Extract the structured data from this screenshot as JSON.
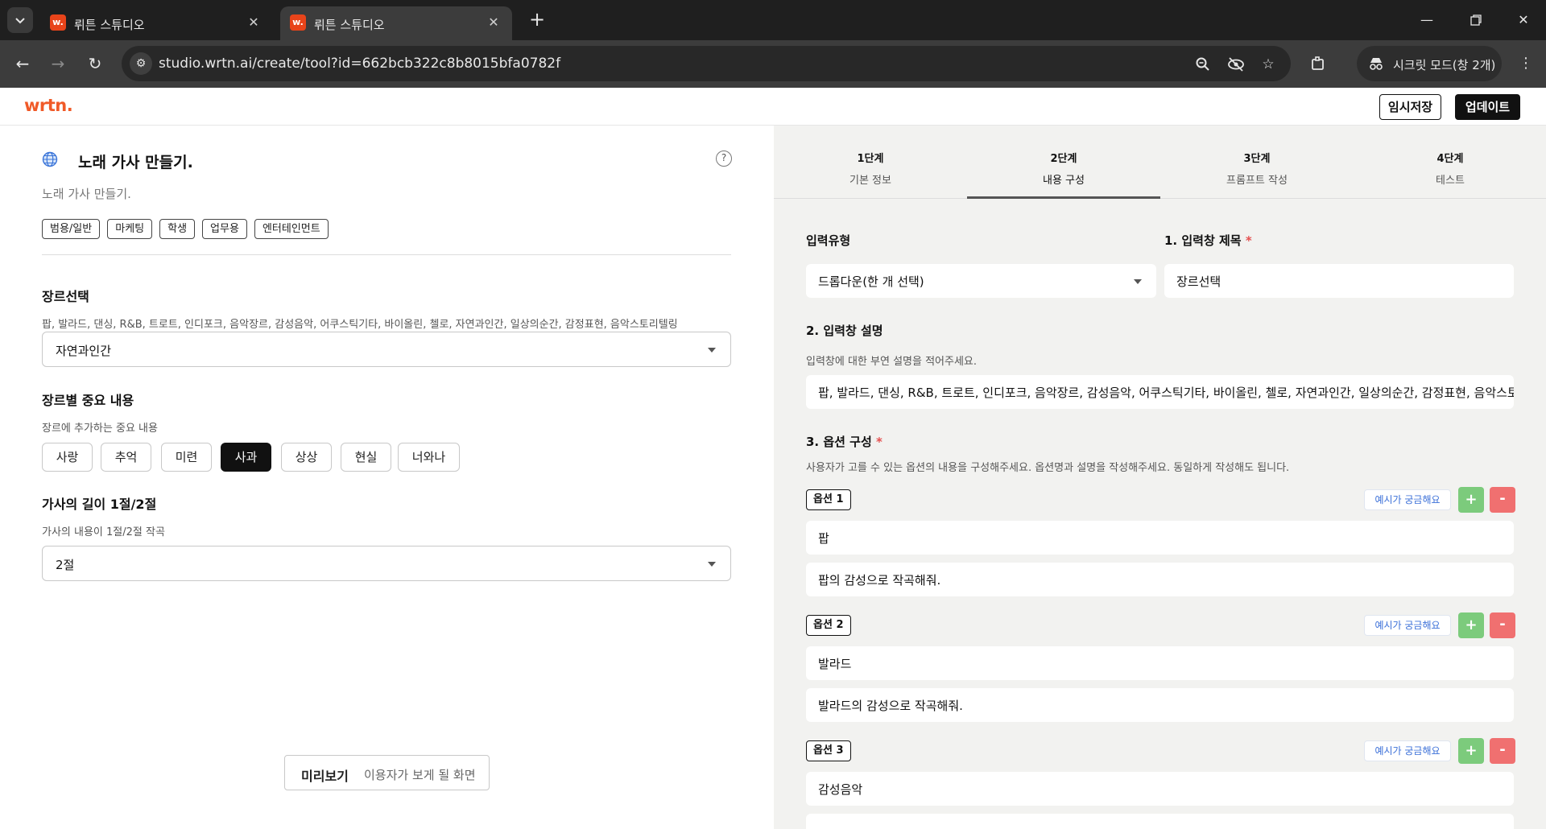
{
  "browser": {
    "tabs": [
      {
        "title": "뤼튼 스튜디오",
        "favicon": "w."
      },
      {
        "title": "뤼튼 스튜디오",
        "favicon": "w."
      }
    ],
    "url": "studio.wrtn.ai/create/tool?id=662bcb322c8b8015bfa0782f",
    "incognito_label": "시크릿 모드(창 2개)",
    "icons": [
      "tab-list-icon",
      "close-icon",
      "new-tab-icon",
      "minimize-icon",
      "restore-icon",
      "window-close-icon",
      "back-icon",
      "forward-icon",
      "reload-icon",
      "site-info-icon",
      "zoom-icon",
      "eye-off-icon",
      "star-icon",
      "extensions-icon",
      "incognito-icon",
      "more-icon"
    ]
  },
  "header": {
    "logo": "wrtn.",
    "save_label": "임시저장",
    "update_label": "업데이트",
    "brand_color": "#f05a28"
  },
  "left": {
    "title": "노래 가사 만들기.",
    "description": "노래 가사 만들기.",
    "tags": [
      "범용/일반",
      "마케팅",
      "학생",
      "업무용",
      "엔터테인먼트"
    ],
    "questions": [
      {
        "title": "장르선택",
        "description": "팝, 발라드, 댄싱, R&B, 트로트, 인디포크, 음악장르, 감성음악, 어쿠스틱기타, 바이올린, 첼로, 자연과인간, 일상의순간, 감정표현, 음악스토리텔링",
        "value": "자연과인간"
      },
      {
        "title": "장르별 중요 내용",
        "description": "장르에 추가하는 중요 내용",
        "chips": [
          "사랑",
          "추억",
          "미련",
          "사과",
          "상상",
          "현실",
          "너와나"
        ],
        "selected": "사과"
      },
      {
        "title": "가사의 길이 1절/2절",
        "description": "가사의 내용이 1절/2절 작곡",
        "value": "2절"
      }
    ],
    "preview": {
      "bold": "미리보기",
      "sub": "이용자가 보게 될 화면"
    }
  },
  "right": {
    "steps": [
      {
        "num": "1단계",
        "label": "기본 정보"
      },
      {
        "num": "2단계",
        "label": "내용 구성"
      },
      {
        "num": "3단계",
        "label": "프롬프트 작성"
      },
      {
        "num": "4단계",
        "label": "테스트"
      }
    ],
    "active_step": 2,
    "input_type_label": "입력유형",
    "input_type_value": "드롭다운(한 개 선택)",
    "input_title_label": "1. 입력창 제목",
    "input_title_value": "장르선택",
    "desc_label": "2. 입력창 설명",
    "desc_hint": "입력창에 대한 부연 설명을 적어주세요.",
    "desc_value": "팝, 발라드, 댄싱, R&B, 트로트, 인디포크, 음악장르, 감성음악, 어쿠스틱기타, 바이올린, 첼로, 자연과인간, 일상의순간, 감정표현, 음악스토리텔링",
    "options_label": "3. 옵션 구성",
    "options_hint": "사용자가 고를 수 있는 옵션의 내용을 구성해주세요. 옵션명과 설명을 작성해주세요. 동일하게 작성해도 됩니다.",
    "example_label": "예시가 궁금해요",
    "plus": "+",
    "minus": "-",
    "required_mark": "*",
    "options": [
      {
        "badge": "옵션 1",
        "name": "팝",
        "desc": "팝의 감성으로 작곡해줘."
      },
      {
        "badge": "옵션 2",
        "name": "발라드",
        "desc": "발라드의 감성으로 작곡해줘."
      },
      {
        "badge": "옵션 3",
        "name": "감성음악",
        "desc": ""
      }
    ]
  }
}
